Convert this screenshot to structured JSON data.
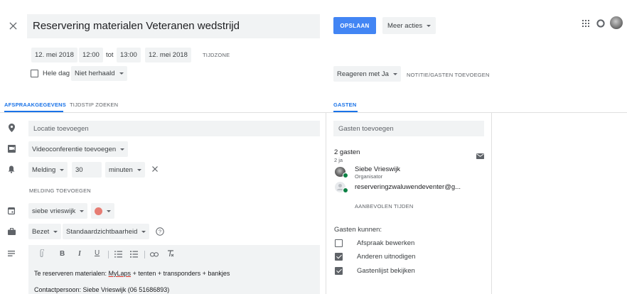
{
  "header": {
    "close_icon": "close-icon",
    "title": "Reservering materialen Veteranen wedstrijd",
    "save_label": "OPSLAAN",
    "more_actions_label": "Meer acties",
    "apps_icon": "apps-grid-icon",
    "account_icon": "account-circle-icon",
    "accent": "#4285f4"
  },
  "datetime": {
    "start_date": "12. mei 2018",
    "start_time": "12:00",
    "to_label": "tot",
    "end_time": "13:00",
    "end_date": "12. mei 2018",
    "timezone_label": "TIJDZONE",
    "all_day_label": "Hele dag",
    "repeat_label": "Niet herhaald"
  },
  "rsvp": {
    "reply_label": "Reageren met Ja",
    "note_label": "NOTITIE/GASTEN TOEVOEGEN"
  },
  "tabs": {
    "details": "AFSPRAAKGEGEVENS",
    "find_time": "TIJDSTIP ZOEKEN",
    "guests": "GASTEN"
  },
  "details": {
    "location_placeholder": "Locatie toevoegen",
    "conference_label": "Videoconferentie toevoegen",
    "notification_type": "Melding",
    "notification_value": "30",
    "notification_unit": "minuten",
    "add_notification": "MELDING TOEVOEGEN",
    "calendar_owner": "siebe vrieswijk",
    "event_color": "#e67c73",
    "busy_label": "Bezet",
    "visibility_label": "Standaardzichtbaarheid",
    "description_line1_prefix": "Te reserveren materialen: ",
    "description_line1_link": "MyLaps",
    "description_line1_suffix": " + tenten + transponders + bankjes",
    "description_line2": "Contactpersoon: Siebe Vrieswijk (06 51686893)"
  },
  "guests": {
    "add_placeholder": "Gasten toevoegen",
    "count": "2 gasten",
    "yes_count": "2 ja",
    "list": [
      {
        "name": "Siebe Vrieswijk",
        "role": "Organisator"
      },
      {
        "name": "reserveringzwaluwendeventer@g...",
        "role": ""
      }
    ],
    "suggested_times": "AANBEVOLEN TIJDEN",
    "permissions_title": "Gasten kunnen:",
    "permissions": [
      {
        "label": "Afspraak bewerken",
        "checked": false
      },
      {
        "label": "Anderen uitnodigen",
        "checked": true
      },
      {
        "label": "Gastenlijst bekijken",
        "checked": true
      }
    ]
  }
}
